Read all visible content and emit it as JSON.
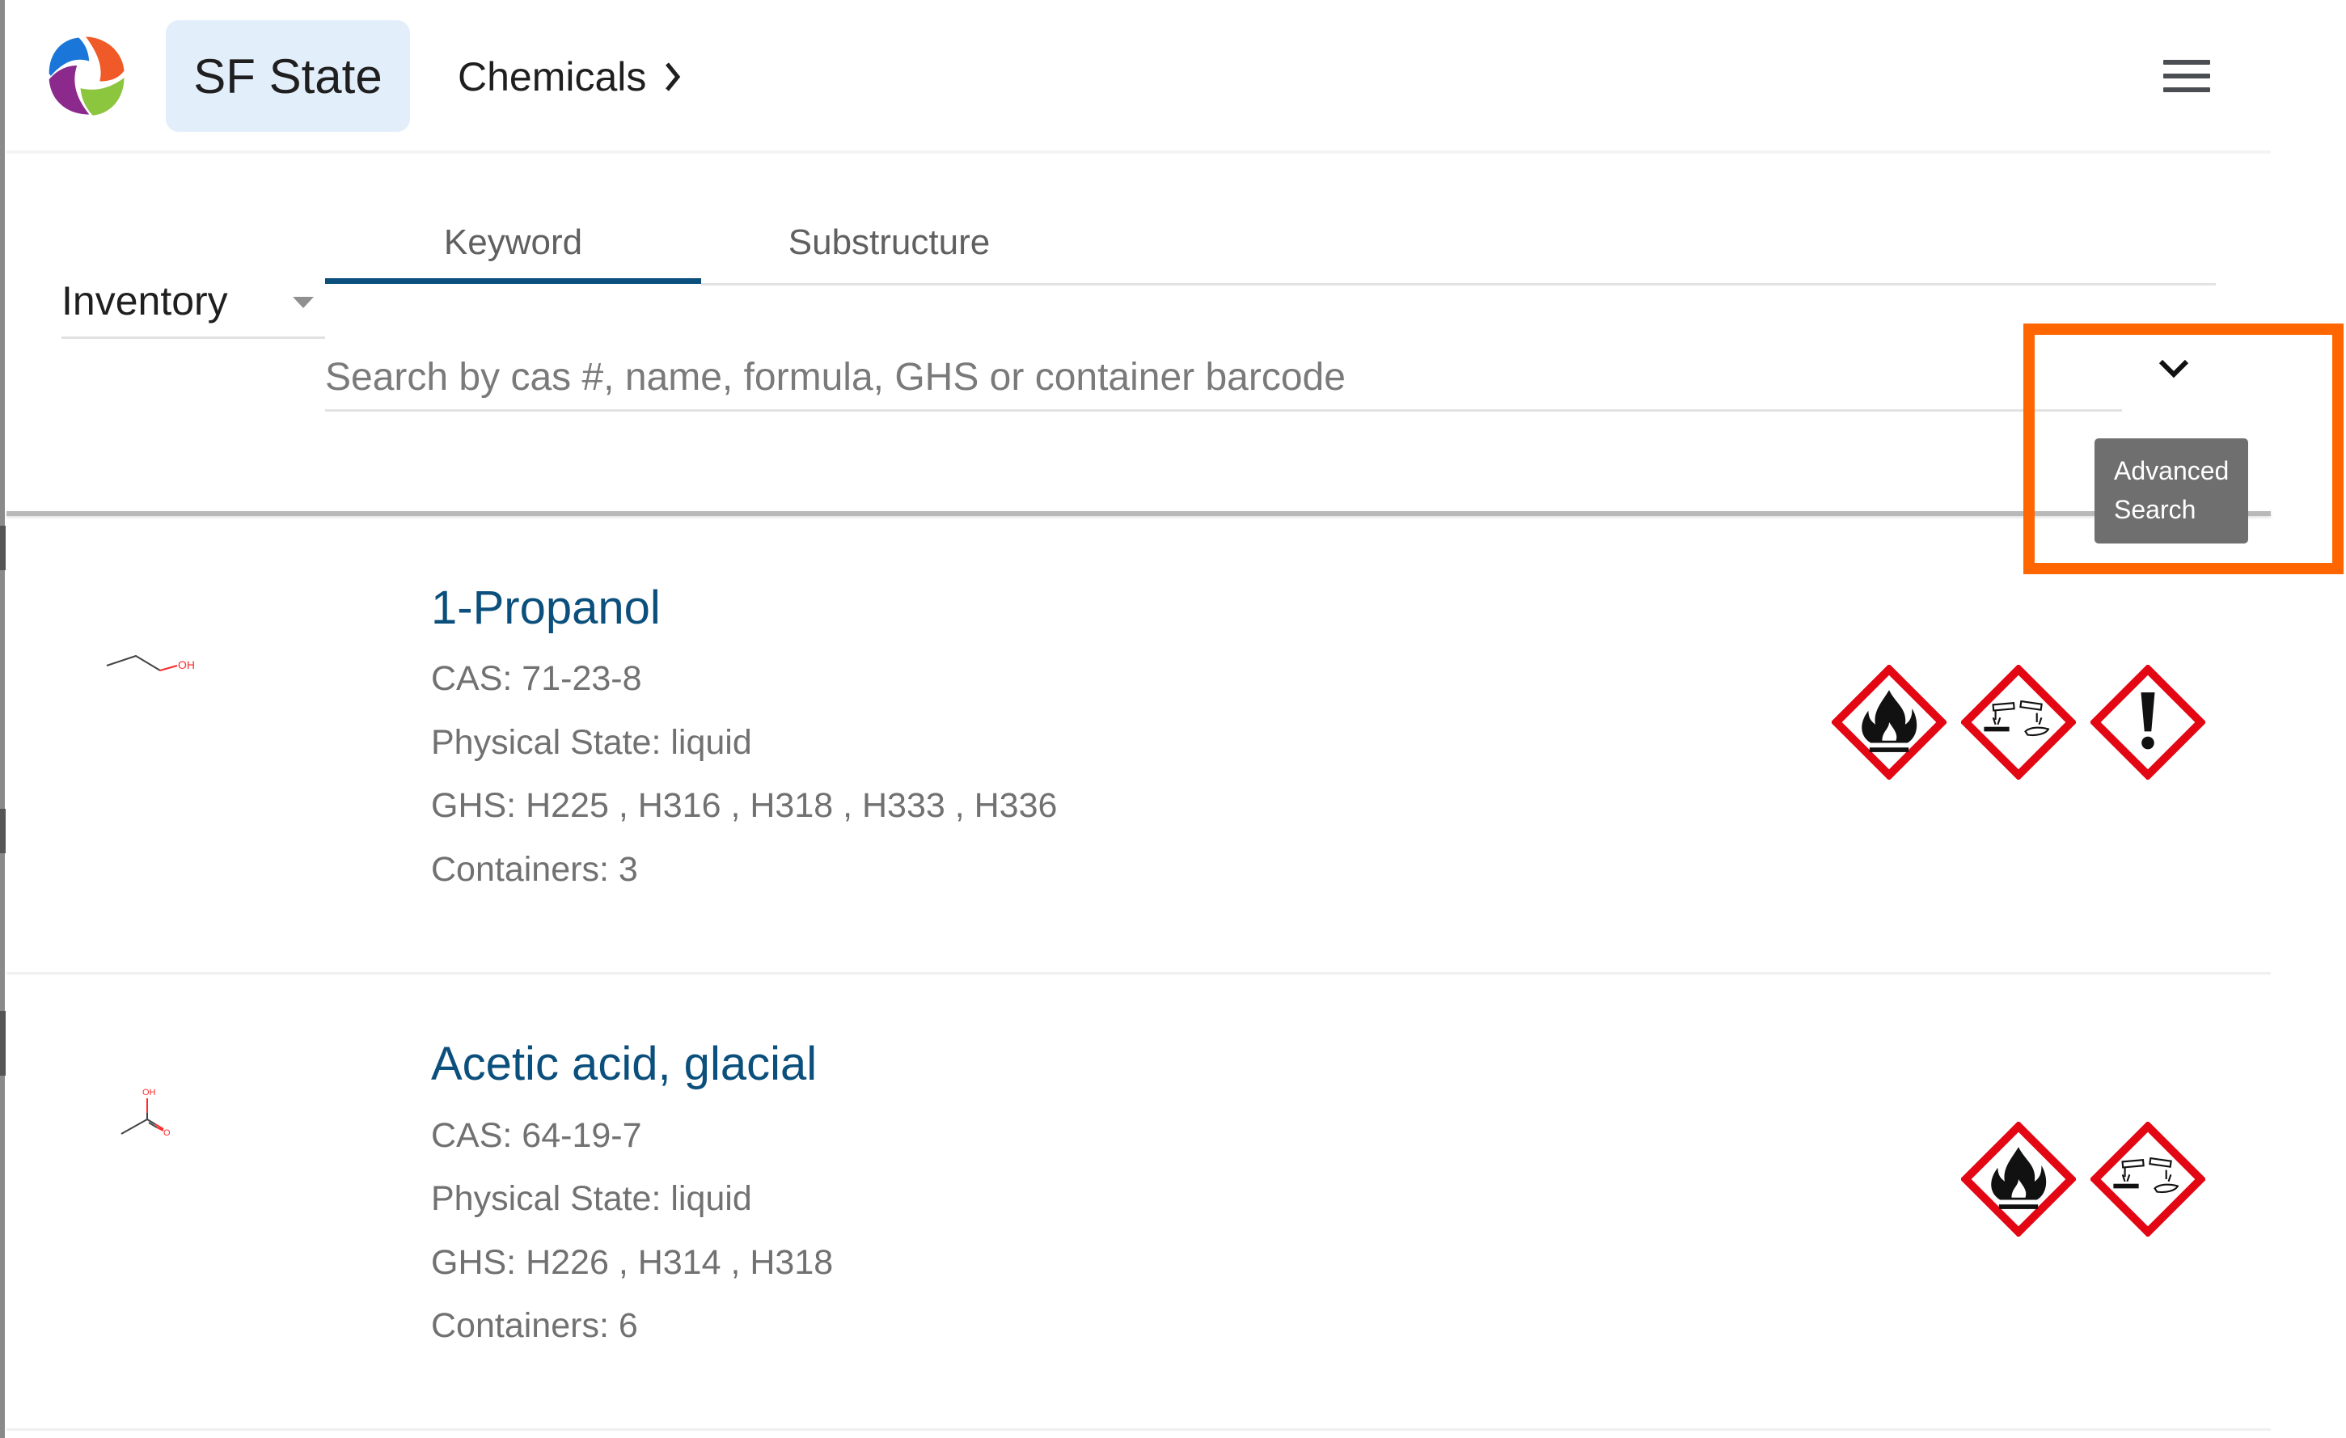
{
  "header": {
    "org_name": "SF State",
    "breadcrumb": "Chemicals",
    "breadcrumb_icon": "chevron-right-icon",
    "menu_icon": "hamburger-menu-icon",
    "logo_colors": [
      "#1a77d9",
      "#f05a28",
      "#8b2a8c",
      "#8cc63f"
    ]
  },
  "search": {
    "scope_select": {
      "selected": "Inventory"
    },
    "tabs": [
      {
        "label": "Keyword",
        "active": true
      },
      {
        "label": "Substructure",
        "active": false
      }
    ],
    "placeholder": "Search by cas #, name, formula, GHS or container barcode",
    "value": "",
    "expand_icon": "chevron-down-icon",
    "tooltip": {
      "line1": "Advanced",
      "line2": "Search"
    },
    "accent_color": "#0b4f7c",
    "highlight_color": "#ff6600"
  },
  "results": [
    {
      "name": "1-Propanol",
      "structure_label": "OH",
      "cas": "CAS: 71-23-8",
      "physical_state": "Physical State: liquid",
      "ghs": "GHS: H225 , H316 , H318 , H333 , H336",
      "containers": "Containers: 3",
      "pictograms": [
        "flame",
        "corrosion",
        "exclamation-mark"
      ]
    },
    {
      "name": "Acetic acid, glacial",
      "structure_labels": [
        "OH",
        "O"
      ],
      "cas": "CAS: 64-19-7",
      "physical_state": "Physical State: liquid",
      "ghs": "GHS: H226 , H314 , H318",
      "containers": "Containers: 6",
      "pictograms": [
        "flame",
        "corrosion"
      ]
    }
  ],
  "colors": {
    "hazard_red": "#e30613",
    "title_blue": "#0b4f7c",
    "tooltip_bg": "#6f6f6f"
  }
}
